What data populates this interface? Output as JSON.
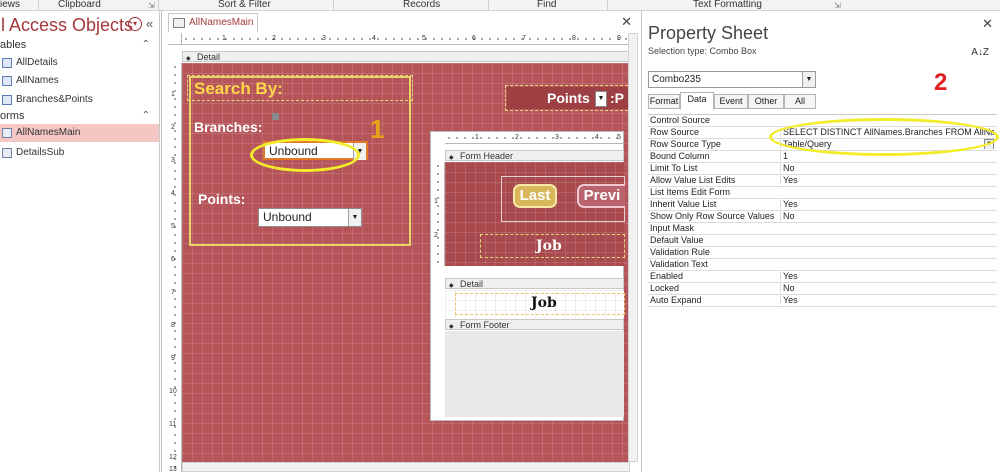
{
  "ribbon": {
    "groups": [
      "iews",
      "Clipboard",
      "Sort & Filter",
      "Records",
      "Find",
      "Text Formatting"
    ]
  },
  "nav": {
    "title": "ll Access Objects",
    "groups": [
      {
        "label": "ables",
        "items": [
          "AllDetails",
          "AllNames",
          "Branches&Points"
        ]
      },
      {
        "label": "orms",
        "items": [
          "AllNamesMain",
          "DetailsSub"
        ]
      }
    ],
    "selected_item": "AllNamesMain"
  },
  "designer": {
    "tab_title": "AllNamesMain",
    "detail_section": "Detail",
    "ruler_top": [
      "1",
      "2",
      "3",
      "4",
      "5",
      "6",
      "7",
      "8",
      "9",
      "10"
    ],
    "ruler_left": [
      "1",
      "2",
      "3",
      "4",
      "5",
      "6",
      "7",
      "8",
      "9",
      "10",
      "11",
      "12",
      "13"
    ],
    "search_by_label": "Search By:",
    "branches_label": "Branches:",
    "branches_combo_value": "Unbound",
    "points_label": "Points:",
    "points_combo_value": "Unbound",
    "points_header_label": "Points",
    "points_header_suffix": ":P",
    "annotation_1": "1",
    "subform": {
      "ruler_top": [
        "1",
        "2",
        "3",
        "4",
        "5"
      ],
      "ruler_left": [
        "1",
        "2"
      ],
      "form_header": "Form Header",
      "detail": "Detail",
      "form_footer": "Form Footer",
      "last_button": "Last",
      "previous_button": "Previ",
      "job_header": "Job",
      "job_detail": "Job"
    }
  },
  "property_sheet": {
    "title": "Property Sheet",
    "selection_type": "Selection type:  Combo Box",
    "sort_icon_text": "A↓Z",
    "object_combo": "Combo235",
    "tabs": [
      "Format",
      "Data",
      "Event",
      "Other",
      "All"
    ],
    "active_tab": "Data",
    "annotation_2": "2",
    "rows": [
      {
        "name": "Control Source",
        "value": ""
      },
      {
        "name": "Row Source",
        "value": "SELECT DISTINCT AllNames.Branches FROM AllName"
      },
      {
        "name": "Row Source Type",
        "value": "Table/Query"
      },
      {
        "name": "Bound Column",
        "value": "1"
      },
      {
        "name": "Limit To List",
        "value": "No"
      },
      {
        "name": "Allow Value List Edits",
        "value": "Yes"
      },
      {
        "name": "List Items Edit Form",
        "value": ""
      },
      {
        "name": "Inherit Value List",
        "value": "Yes"
      },
      {
        "name": "Show Only Row Source Values",
        "value": "No"
      },
      {
        "name": "Input Mask",
        "value": ""
      },
      {
        "name": "Default Value",
        "value": ""
      },
      {
        "name": "Validation Rule",
        "value": ""
      },
      {
        "name": "Validation Text",
        "value": ""
      },
      {
        "name": "Enabled",
        "value": "Yes"
      },
      {
        "name": "Locked",
        "value": "No"
      },
      {
        "name": "Auto Expand",
        "value": "Yes"
      }
    ]
  },
  "colors": {
    "accent": "#a4373a",
    "grid_background": "#b65559",
    "annotation_ellipse": "#f2ec2a",
    "annotation_number": "#e8a317",
    "annotation_number_2": "#e02020"
  }
}
